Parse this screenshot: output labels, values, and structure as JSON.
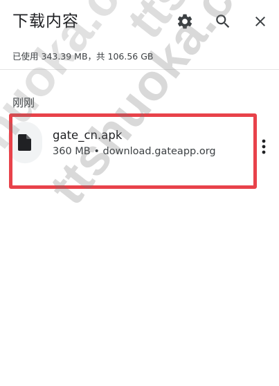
{
  "header": {
    "title": "下载内容",
    "icons": [
      "settings-gear-icon",
      "search-icon",
      "close-icon"
    ]
  },
  "storage": {
    "text": "已使用 343.39 MB，共 106.56 GB"
  },
  "section": {
    "label": "刚刚"
  },
  "downloads": [
    {
      "file_name": "gate_cn.apk",
      "meta": "360 MB • download.gateapp.org",
      "icon": "file-icon"
    }
  ],
  "watermark": {
    "text": "ttshuoka.com"
  },
  "colors": {
    "highlight": "#e8424a",
    "text_primary": "#202124",
    "text_secondary": "#3c4043",
    "icon": "#3c4043"
  }
}
